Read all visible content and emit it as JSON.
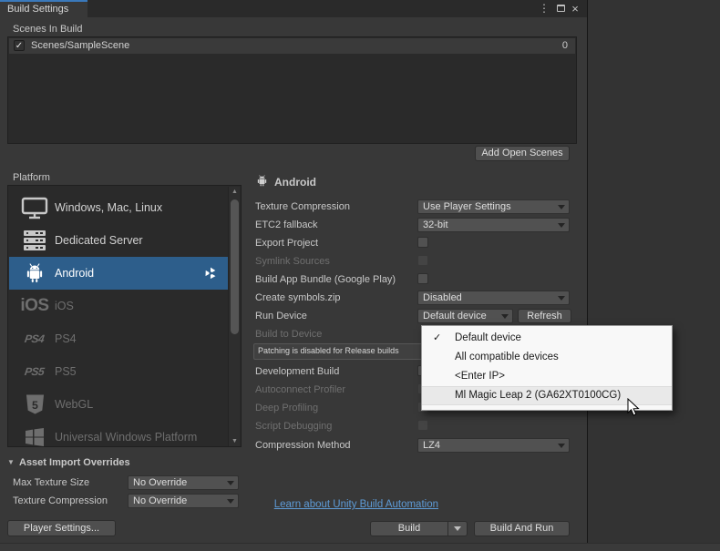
{
  "window": {
    "tab_title": "Build Settings"
  },
  "glyphs": {
    "menu": "⋮",
    "close": "×",
    "check": "✓",
    "scroll_up": "▲",
    "scroll_down": "▼",
    "foldout": "▼"
  },
  "scenes": {
    "header": "Scenes In Build",
    "row": {
      "label": "Scenes/SampleScene",
      "checked": true,
      "index": "0"
    },
    "add_button": "Add Open Scenes"
  },
  "platform": {
    "header": "Platform",
    "items": [
      {
        "label": "Windows, Mac, Linux",
        "icon": "monitor-icon",
        "enabled": true,
        "selected": false
      },
      {
        "label": "Dedicated Server",
        "icon": "server-icon",
        "enabled": true,
        "selected": false
      },
      {
        "label": "Android",
        "icon": "android-icon",
        "enabled": true,
        "selected": true
      },
      {
        "label": "iOS",
        "icon": "ios-icon",
        "icon_text": "iOS",
        "enabled": false,
        "selected": false
      },
      {
        "label": "PS4",
        "icon": "ps4-icon",
        "icon_text": "PS4",
        "enabled": false,
        "selected": false
      },
      {
        "label": "PS5",
        "icon": "ps5-icon",
        "icon_text": "PS5",
        "enabled": false,
        "selected": false
      },
      {
        "label": "WebGL",
        "icon": "webgl-icon",
        "enabled": false,
        "selected": false
      },
      {
        "label": "Universal Windows Platform",
        "icon": "windows-icon",
        "enabled": false,
        "selected": false
      }
    ]
  },
  "android": {
    "header": "Android",
    "texture_compression": {
      "label": "Texture Compression",
      "value": "Use Player Settings"
    },
    "etc2_fallback": {
      "label": "ETC2 fallback",
      "value": "32-bit"
    },
    "export_project": {
      "label": "Export Project",
      "checked": false
    },
    "symlink_sources": {
      "label": "Symlink Sources",
      "checked": false,
      "enabled": false
    },
    "build_app_bundle": {
      "label": "Build App Bundle (Google Play)",
      "checked": false
    },
    "create_symbols": {
      "label": "Create symbols.zip",
      "value": "Disabled"
    },
    "run_device": {
      "label": "Run Device",
      "value": "Default device",
      "refresh_label": "Refresh"
    },
    "build_to_device": {
      "label": "Build to Device",
      "enabled": false
    },
    "patch_note": "Patching is disabled for Release builds",
    "development_build": {
      "label": "Development Build",
      "checked": false
    },
    "autoconnect_profiler": {
      "label": "Autoconnect Profiler",
      "checked": false,
      "enabled": false
    },
    "deep_profiling": {
      "label": "Deep Profiling",
      "checked": false,
      "enabled": false
    },
    "script_debugging": {
      "label": "Script Debugging",
      "checked": false,
      "enabled": false
    },
    "compression_method": {
      "label": "Compression Method",
      "value": "LZ4"
    }
  },
  "device_menu": {
    "items": [
      {
        "label": "Default device",
        "checked": true,
        "hovered": false
      },
      {
        "label": "All compatible devices",
        "checked": false,
        "hovered": false
      },
      {
        "label": "<Enter IP>",
        "checked": false,
        "hovered": false
      },
      {
        "label": "Ml Magic Leap 2 (GA62XT0100CG)",
        "checked": false,
        "hovered": true
      }
    ]
  },
  "overrides": {
    "header": "Asset Import Overrides",
    "max_texture_size": {
      "label": "Max Texture Size",
      "value": "No Override"
    },
    "texture_compression": {
      "label": "Texture Compression",
      "value": "No Override"
    }
  },
  "footer": {
    "player_settings": "Player Settings...",
    "link": "Learn about Unity Build Automation",
    "build": "Build",
    "build_and_run": "Build And Run"
  },
  "colors": {
    "selection_blue": "#2d5e8b",
    "tab_accent": "#3a79bb",
    "link_blue": "#5e9bd6",
    "window_bg": "#383838",
    "panel_bg": "#2a2a2a",
    "popup_bg": "#f8f8f8"
  }
}
